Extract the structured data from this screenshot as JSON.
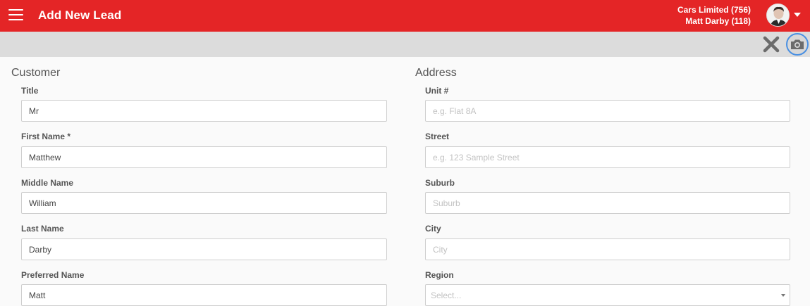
{
  "header": {
    "title": "Add New Lead",
    "company": "Cars Limited (756)",
    "user": "Matt Darby (118)",
    "accent_color": "#e42526"
  },
  "toolbar": {
    "close_icon": "close-icon",
    "camera_icon": "camera-icon"
  },
  "customer": {
    "section_title": "Customer",
    "title_label": "Title",
    "title_value": "Mr",
    "first_name_label": "First Name *",
    "first_name_value": "Matthew",
    "middle_name_label": "Middle Name",
    "middle_name_value": "William",
    "last_name_label": "Last Name",
    "last_name_value": "Darby",
    "preferred_name_label": "Preferred Name",
    "preferred_name_value": "Matt"
  },
  "address": {
    "section_title": "Address",
    "unit_label": "Unit #",
    "unit_placeholder": "e.g. Flat 8A",
    "street_label": "Street",
    "street_placeholder": "e.g. 123 Sample Street",
    "suburb_label": "Suburb",
    "suburb_placeholder": "Suburb",
    "city_label": "City",
    "city_placeholder": "City",
    "region_label": "Region",
    "region_placeholder": "Select..."
  }
}
